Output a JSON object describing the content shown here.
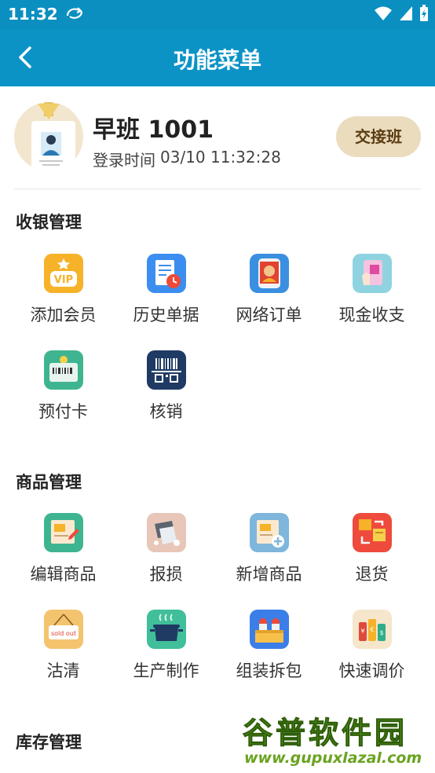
{
  "status_bar": {
    "time": "11:32",
    "sync_icon": "sync-icon",
    "wifi_icon": "wifi-icon",
    "signal_icon": "signal-icon",
    "battery_icon": "battery-charging-icon"
  },
  "app_bar": {
    "title": "功能菜单",
    "back_icon": "back-arrow-icon"
  },
  "profile": {
    "shift_name": "早班 1001",
    "login_label": "登录时间",
    "login_time": "03/10 11:32:28",
    "handover_label": "交接班"
  },
  "sections": [
    {
      "title": "收银管理",
      "items": [
        {
          "label": "添加会员",
          "icon": "vip-icon"
        },
        {
          "label": "历史单据",
          "icon": "history-receipt-icon"
        },
        {
          "label": "网络订单",
          "icon": "online-order-icon"
        },
        {
          "label": "现金收支",
          "icon": "cash-icon"
        },
        {
          "label": "预付卡",
          "icon": "prepaid-card-icon"
        },
        {
          "label": "核销",
          "icon": "barcode-scan-icon"
        }
      ]
    },
    {
      "title": "商品管理",
      "items": [
        {
          "label": "编辑商品",
          "icon": "edit-product-icon"
        },
        {
          "label": "报损",
          "icon": "damage-report-icon"
        },
        {
          "label": "新增商品",
          "icon": "add-product-icon"
        },
        {
          "label": "退货",
          "icon": "return-goods-icon"
        },
        {
          "label": "沽清",
          "icon": "sold-out-icon",
          "badge_text": "sold out"
        },
        {
          "label": "生产制作",
          "icon": "cooking-pot-icon"
        },
        {
          "label": "组装拆包",
          "icon": "assemble-package-icon"
        },
        {
          "label": "快速调价",
          "icon": "price-tag-icon"
        }
      ]
    },
    {
      "title": "库存管理",
      "items": []
    }
  ],
  "watermark": {
    "title": "谷普软件园",
    "url": "www.gupuxlazal.com"
  }
}
